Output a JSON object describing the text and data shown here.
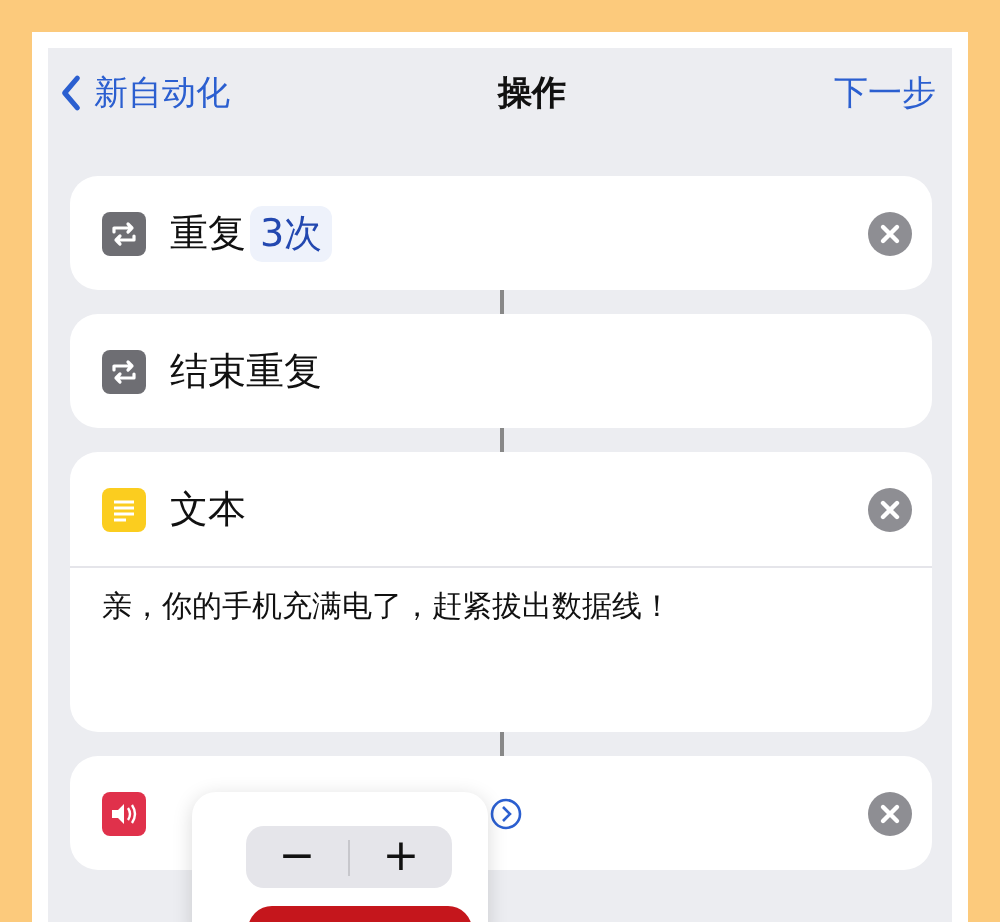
{
  "nav": {
    "back": "新自动化",
    "title": "操作",
    "next": "下一步"
  },
  "actions": [
    {
      "kind": "repeat",
      "title": "重复",
      "token": "3次",
      "removable": true
    },
    {
      "kind": "end-repeat",
      "title": "结束重复",
      "removable": false
    },
    {
      "kind": "text",
      "title": "文本",
      "body": "亲，你的手机充满电了，赶紧拔出数据线！",
      "removable": true
    },
    {
      "kind": "speak",
      "removable": true
    }
  ],
  "popover": {
    "minus": "−",
    "plus": "+"
  }
}
